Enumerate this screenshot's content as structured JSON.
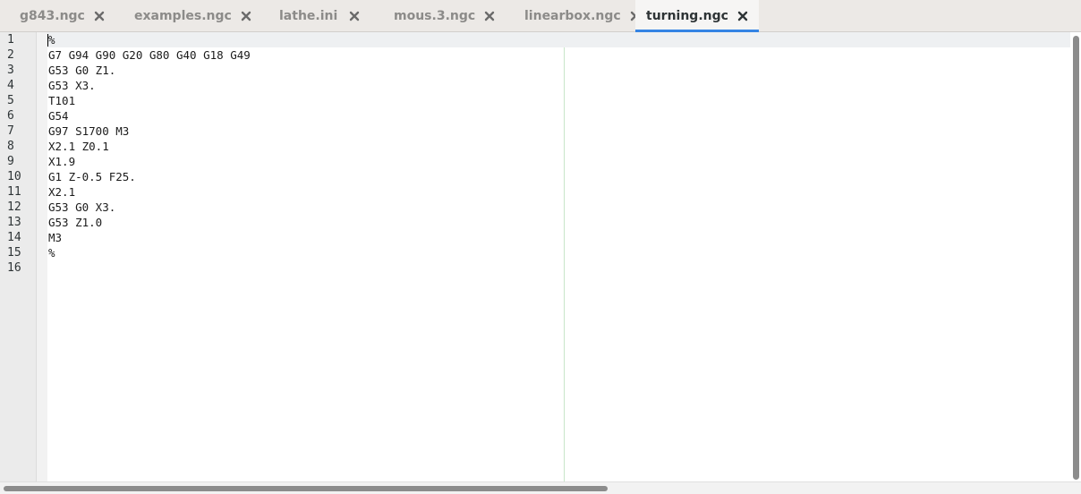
{
  "tabs": [
    {
      "label": "g843.ngc",
      "active": false
    },
    {
      "label": "examples.ngc",
      "active": false
    },
    {
      "label": "lathe.ini",
      "active": false
    },
    {
      "label": "mous.3.ngc",
      "active": false
    },
    {
      "label": "linearbox.ngc",
      "active": false
    },
    {
      "label": "turning.ngc",
      "active": true
    }
  ],
  "editor": {
    "current_line": 1,
    "lines": [
      "%",
      "G7 G94 G90 G20 G80 G40 G18 G49",
      "G53 G0 Z1.",
      "G53 X3.",
      "T101",
      "G54",
      "G97 S1700 M3",
      "X2.1 Z0.1",
      "X1.9",
      "G1 Z-0.5 F25.",
      "X2.1",
      "G53 G0 X3.",
      "G53 Z1.0",
      "M3",
      "%",
      ""
    ]
  },
  "colors": {
    "accent": "#3584e4",
    "tab_bar": "#ece9e6",
    "gutter": "#ebebeb",
    "margin_line": "#c8e6c9"
  }
}
